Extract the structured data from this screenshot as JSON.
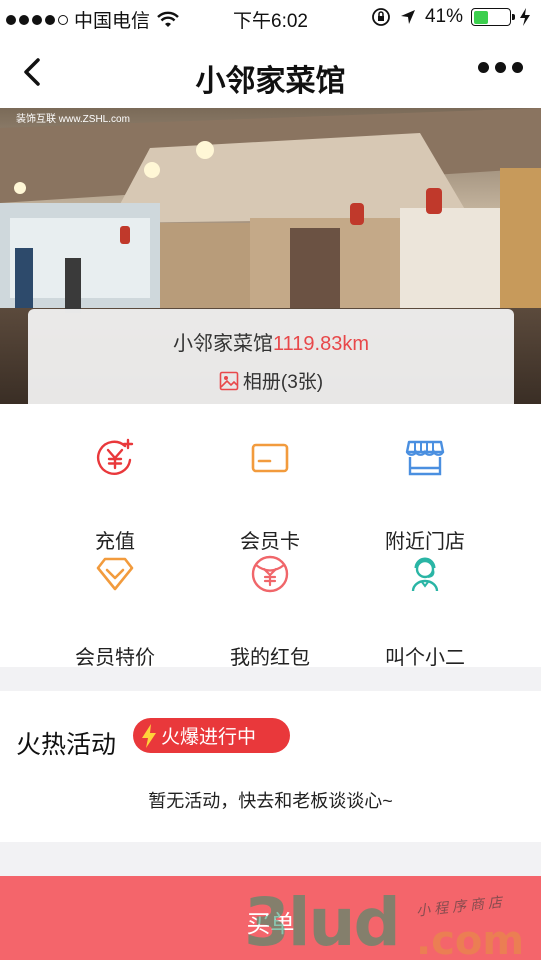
{
  "status_bar": {
    "carrier": "中国电信",
    "time": "下午6:02",
    "battery": "41%",
    "battery_level": 0.41
  },
  "navbar": {
    "title": "小邻家菜馆",
    "back_icon": "chevron-left-icon",
    "more_icon": "more-dots-icon"
  },
  "hero": {
    "photo_caption": "装饰互联 www.ZSHL.com",
    "store_name": "小邻家菜馆",
    "distance": "1119.83km",
    "album_label": "相册(3张)",
    "album_icon": "image-icon"
  },
  "menu": {
    "items": [
      {
        "label": "充值",
        "icon": "recharge-yen-icon"
      },
      {
        "label": "会员卡",
        "icon": "card-icon"
      },
      {
        "label": "附近门店",
        "icon": "storefront-icon"
      },
      {
        "label": "会员特价",
        "icon": "diamond-icon"
      },
      {
        "label": "我的红包",
        "icon": "red-envelope-yen-icon"
      },
      {
        "label": "叫个小二",
        "icon": "waiter-icon"
      }
    ]
  },
  "activity": {
    "heading": "火热活动",
    "badge": "火爆进行中",
    "badge_icon": "lightning-icon",
    "empty_text": "暂无活动，快去和老板谈谈心~"
  },
  "footer": {
    "buy_label": "买单"
  },
  "watermark": {
    "main": "3lud",
    "domain": ".com",
    "tag": "小程序商店"
  },
  "colors": {
    "accent_red": "#e9383b",
    "buy_bar": "#f4656b",
    "orange": "#f29b3d",
    "blue": "#4a8fe0",
    "teal": "#2ab5a5"
  }
}
